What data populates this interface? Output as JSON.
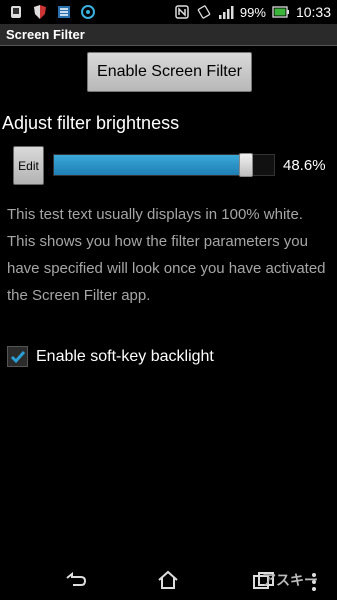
{
  "status_bar": {
    "battery": "99%",
    "time": "10:33",
    "icons": [
      "phone-icon",
      "shield-icon",
      "dev-icon",
      "sync-icon",
      "nfc-icon",
      "rotate-icon",
      "signal-icon",
      "battery-icon"
    ]
  },
  "app": {
    "title": "Screen Filter"
  },
  "main": {
    "enable_button_label": "Enable Screen Filter",
    "brightness_heading": "Adjust filter brightness",
    "edit_button_label": "Edit",
    "brightness_value": 48.6,
    "brightness_text": "48.6%",
    "description": "This test text usually displays in 100% white. This shows you how the filter parameters you have specified will look once you have activated the Screen Filter app.",
    "softkey_label": "Enable soft-key backlight",
    "softkey_checked": true
  },
  "navigation": {
    "watermark": "アスキー",
    "items": [
      "back-icon",
      "home-icon",
      "recent-apps-icon",
      "menu-icon"
    ]
  },
  "colors": {
    "accent": "#2a9fd6",
    "background": "#000000",
    "description_text": "#a6a6a6"
  }
}
